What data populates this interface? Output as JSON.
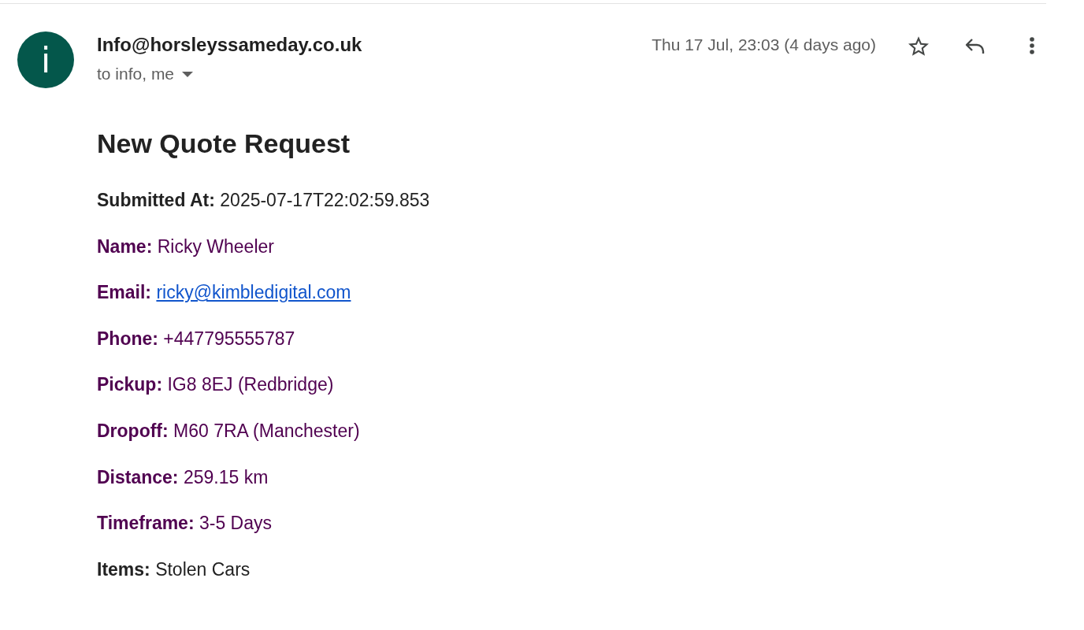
{
  "header": {
    "avatar_letter": "i",
    "sender": "Info@horsleyssameday.co.uk",
    "recipients": "to info, me",
    "date": "Thu 17 Jul, 23:03 (4 days ago)",
    "starred": false
  },
  "body": {
    "title": "New Quote Request",
    "fields": [
      {
        "label": "Submitted At:",
        "value": "2025-07-17T22:02:59.853",
        "kind": "text",
        "color": "#222222"
      },
      {
        "label": "Name:",
        "value": "Ricky Wheeler",
        "kind": "text",
        "color": "#500050"
      },
      {
        "label": "Email:",
        "value": "ricky@kimbledigital.com",
        "kind": "link",
        "color": "#500050"
      },
      {
        "label": "Phone:",
        "value": "+447795555787",
        "kind": "text",
        "color": "#500050"
      },
      {
        "label": "Pickup:",
        "value": "IG8 8EJ (Redbridge)",
        "kind": "text",
        "color": "#500050"
      },
      {
        "label": "Dropoff:",
        "value": "M60 7RA (Manchester)",
        "kind": "text",
        "color": "#500050"
      },
      {
        "label": "Distance:",
        "value": "259.15 km",
        "kind": "text",
        "color": "#500050"
      },
      {
        "label": "Timeframe:",
        "value": "3-5 Days",
        "kind": "text",
        "color": "#500050"
      },
      {
        "label": "Items:",
        "value": "Stolen Cars",
        "kind": "text",
        "color": "#222222"
      }
    ]
  }
}
